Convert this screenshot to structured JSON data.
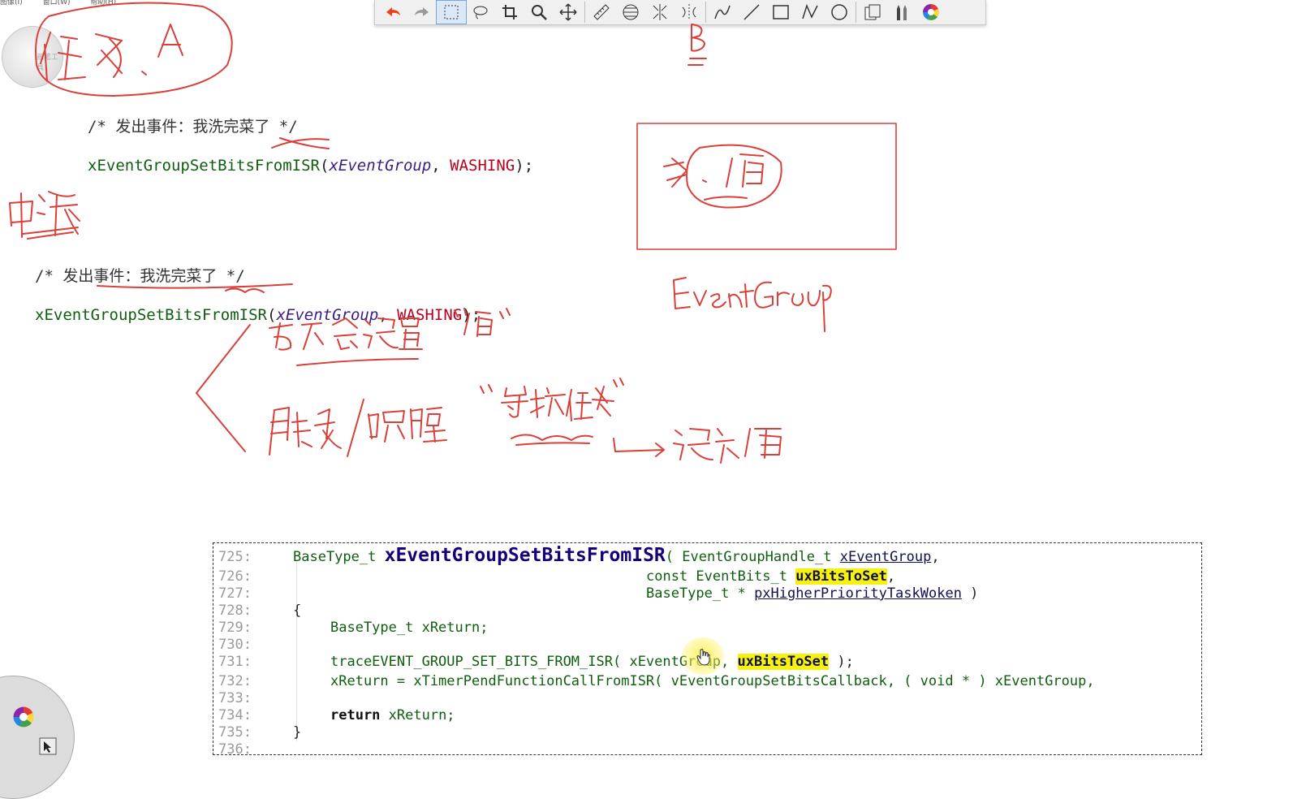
{
  "menubar": {
    "items": [
      "图像(I)",
      "窗口(W)",
      "帮助(H)"
    ]
  },
  "toolbar": {
    "tools": [
      "undo-icon",
      "redo-icon",
      "rectangle-select-icon",
      "lasso-icon",
      "crop-icon",
      "zoom-icon",
      "move-icon",
      "ruler-icon",
      "globe-icon",
      "mirror-icon",
      "flip-icon",
      "pen-icon",
      "line-icon",
      "rectangle-icon",
      "polyline-icon",
      "circle-icon",
      "copy-icon",
      "pencils-icon",
      "color-wheel-icon"
    ],
    "selected": "rectangle-select-icon"
  },
  "dial": {
    "label": "画笔工具"
  },
  "task_a_block": {
    "comment_prefix": "/* ",
    "comment_text": "发出事件：我洗完菜了",
    "comment_suffix": " */",
    "func": "xEventGroupSetBitsFromISR",
    "open": "(",
    "arg1": "xEventGroup",
    "sep": ", ",
    "arg2": "WASHING",
    "close": ");"
  },
  "isr_block": {
    "comment_prefix": "/* ",
    "comment_text": "发出事件：我洗完菜了",
    "comment_suffix": " */",
    "func": "xEventGroupSetBitsFromISR",
    "open": "(",
    "arg1": "xEventGroup",
    "sep": ", ",
    "arg2": "WASHING",
    "close": ");"
  },
  "code_listing": {
    "lines": [
      {
        "n": "725:",
        "a": "BaseType_t ",
        "b": "xEventGroupSetBitsFromISR",
        "c": "( EventGroupHandle_t ",
        "d": "xEventGroup",
        ",": ","
      },
      {
        "n": "726:",
        "a": "const EventBits_t ",
        "b": "uxBitsToSet",
        "c": ","
      },
      {
        "n": "727:",
        "a": "BaseType_t * ",
        "b": "pxHigherPriorityTaskWoken",
        "c": " )"
      },
      {
        "n": "728:",
        "a": "{"
      },
      {
        "n": "729:",
        "a": "BaseType_t xReturn;"
      },
      {
        "n": "730:"
      },
      {
        "n": "731:",
        "a": "traceEVENT_GROUP_SET_BITS_FROM_ISR( xEventGroup, ",
        "b": "uxBitsToSet",
        "c": " );"
      },
      {
        "n": "732:",
        "a": "xReturn = xTimerPendFunctionCallFromISR( vEventGroupSetBitsCallback, ( void * ) xEventGroup,"
      },
      {
        "n": "733:"
      },
      {
        "n": "734:",
        "k": "return",
        "a": " xReturn;"
      },
      {
        "n": "735:",
        "a": "}"
      },
      {
        "n": "736:"
      }
    ]
  },
  "colors": {
    "ink": "#d9403a",
    "highlight": "#f6f20c",
    "func_green": "#0f5e0f",
    "macro_red": "#b8001f"
  }
}
